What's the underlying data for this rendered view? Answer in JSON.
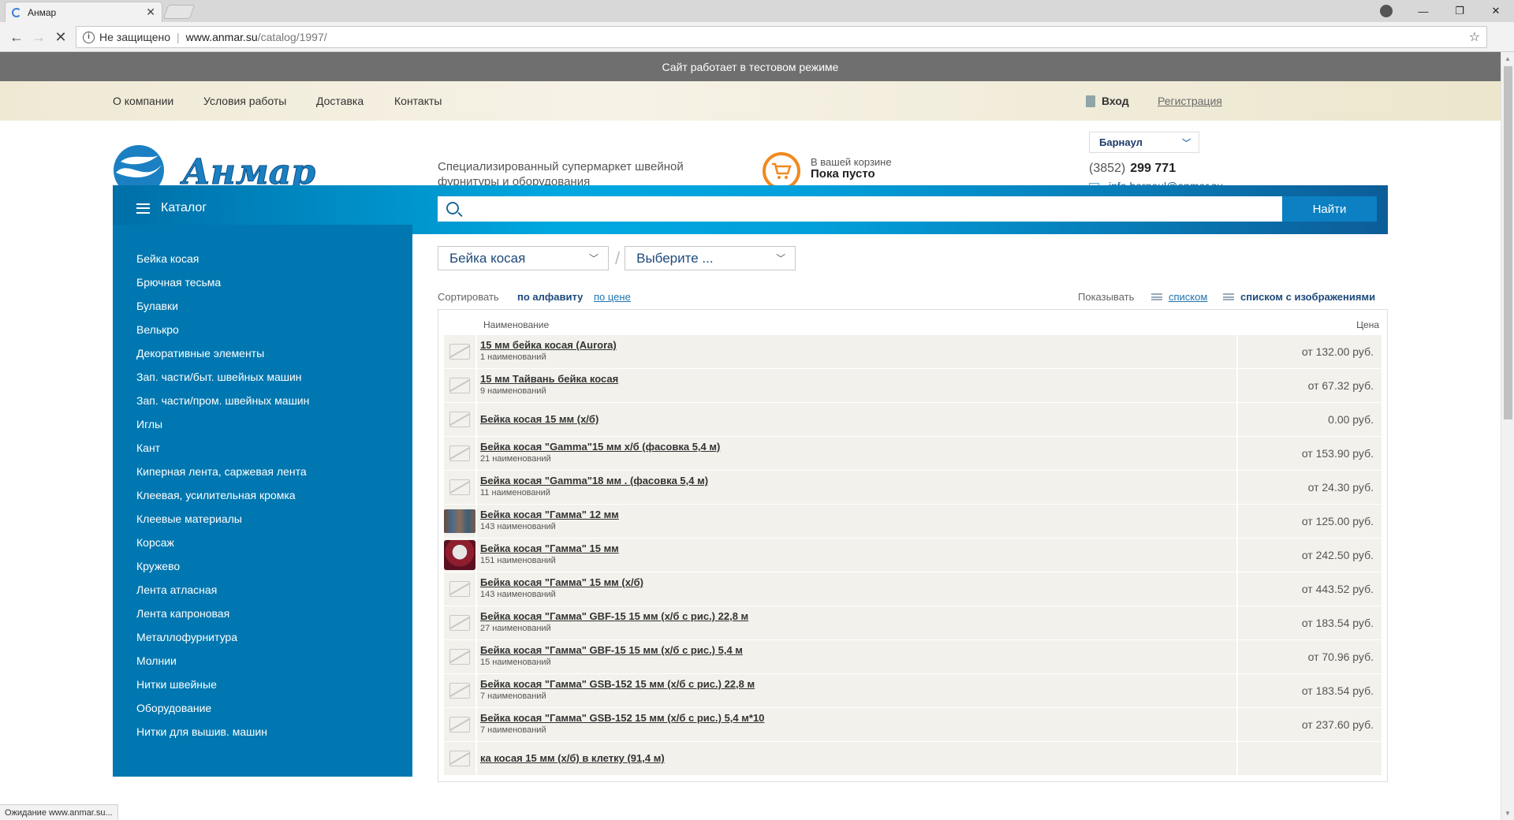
{
  "browser": {
    "tab_title": "Анмар",
    "security_label": "Не защищено",
    "url_host": "www.anmar.su",
    "url_path": "/catalog/1997/",
    "status": "Ожидание www.anmar.su..."
  },
  "site": {
    "test_notice": "Сайт работает в тестовом режиме",
    "topnav": [
      "О компании",
      "Условия работы",
      "Доставка",
      "Контакты"
    ],
    "login": "Вход",
    "register": "Регистрация",
    "tagline": "Специализированный супермаркет швейной фурнитуры и оборудования",
    "cart_line1": "В вашей корзине",
    "cart_line2": "Пока пусто",
    "city": "Барнаул",
    "phone_code": "(3852)",
    "phone_number": "299 771",
    "email": "info.barnaul@anmar.su"
  },
  "catalog": {
    "label": "Каталог",
    "search_button": "Найти",
    "items": [
      "Бейка косая",
      "Брючная тесьма",
      "Булавки",
      "Велькро",
      "Декоративные элементы",
      "Зап. части/быт. швейных машин",
      "Зап. части/пром. швейных машин",
      "Иглы",
      "Кант",
      "Киперная лента, саржевая лента",
      "Клеевая, усилительная кромка",
      "Клеевые материалы",
      "Корсаж",
      "Кружево",
      "Лента атласная",
      "Лента капроновая",
      "Металлофурнитура",
      "Молнии",
      "Нитки швейные",
      "Оборудование",
      "Нитки для вышив. машин"
    ]
  },
  "filters": {
    "category": "Бейка косая",
    "subcategory": "Выберите ..."
  },
  "sort": {
    "label": "Сортировать",
    "alpha": "по алфавиту",
    "price": "по цене",
    "show_label": "Показывать",
    "view_list": "списком",
    "view_images": "списком с изображениями"
  },
  "table": {
    "col_name": "Наименование",
    "col_price": "Цена",
    "rows": [
      {
        "title": "15 мм бейка косая (Aurora)",
        "count": "1 наименований",
        "price": "от 132.00 руб.",
        "img": "none"
      },
      {
        "title": "15 мм Тайвань бейка косая",
        "count": "9 наименований",
        "price": "от 67.32 руб.",
        "img": "none"
      },
      {
        "title": "Бейка косая 15 мм (х/б)",
        "count": "",
        "price": "0.00 руб.",
        "img": "none"
      },
      {
        "title": "Бейка косая \"Gamma\"15 мм х/б (фасовка 5,4 м)",
        "count": "21 наименований",
        "price": "от 153.90 руб.",
        "img": "none"
      },
      {
        "title": "Бейка косая \"Gamma\"18 мм . (фасовка 5,4 м)",
        "count": "11 наименований",
        "price": "от 24.30 руб.",
        "img": "none"
      },
      {
        "title": "Бейка косая \"Гамма\" 12 мм",
        "count": "143 наименований",
        "price": "от 125.00 руб.",
        "img": "photo1"
      },
      {
        "title": "Бейка косая \"Гамма\" 15 мм",
        "count": "151 наименований",
        "price": "от 242.50 руб.",
        "img": "photo2"
      },
      {
        "title": "Бейка косая \"Гамма\" 15 мм (х/б)",
        "count": "143 наименований",
        "price": "от 443.52 руб.",
        "img": "none"
      },
      {
        "title": "Бейка косая \"Гамма\" GBF-15 15 мм (х/б с рис.) 22,8 м",
        "count": "27 наименований",
        "price": "от 183.54 руб.",
        "img": "none"
      },
      {
        "title": "Бейка косая \"Гамма\" GBF-15 15 мм (х/б с рис.) 5,4 м",
        "count": "15 наименований",
        "price": "от 70.96 руб.",
        "img": "none"
      },
      {
        "title": "Бейка косая \"Гамма\" GSB-152 15 мм (х/б с рис.) 22,8 м",
        "count": "7 наименований",
        "price": "от 183.54 руб.",
        "img": "none"
      },
      {
        "title": "Бейка косая \"Гамма\" GSB-152 15 мм (х/б с рис.) 5,4 м*10",
        "count": "7 наименований",
        "price": "от 237.60 руб.",
        "img": "none"
      },
      {
        "title": "ка косая 15 мм (х/б) в клетку (91,4 м)",
        "count": "",
        "price": "",
        "img": "none"
      }
    ]
  },
  "colors": {
    "brand_blue": "#0077b0",
    "accent_orange": "#f1891f"
  }
}
